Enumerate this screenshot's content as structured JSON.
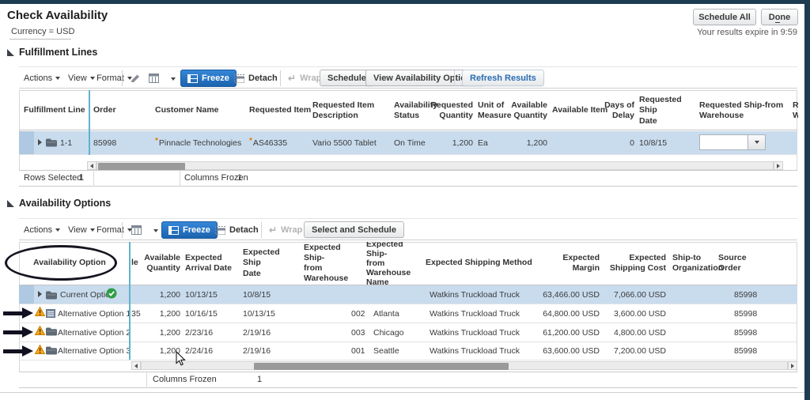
{
  "colors": {
    "frame": "#1d3c52",
    "primary_button": "#2272c3",
    "selected_row": "#c9dcee",
    "frozen_divider": "#5fb3cd",
    "link_blue": "#2a6db5",
    "warning": "#f6a81f",
    "success": "#2f9e47",
    "annotation": "#15151f",
    "required_marker": "#e07c00"
  },
  "header": {
    "title": "Check Availability",
    "subtitle": "Currency = USD",
    "schedule_all_label": "Schedule All",
    "done": {
      "pre": "D",
      "accent": "o",
      "post": "ne"
    },
    "expire_note": "Your results expire in 9:59"
  },
  "toolbar": {
    "actions": "Actions",
    "view": "View",
    "format": "Format",
    "freeze": "Freeze",
    "detach": "Detach",
    "wrap": "Wrap"
  },
  "fulfillment": {
    "section_title": "Fulfillment Lines",
    "schedule_label": "Schedule",
    "view_options_label": "View Availability Options",
    "refresh_label": "Refresh Results",
    "columns": {
      "line": "Fulfillment Line",
      "order": "Order",
      "customer": "Customer Name",
      "item": "Requested Item",
      "description": "Requested Item\nDescription",
      "status": "Availability\nStatus",
      "req_qty": "Requested\nQuantity",
      "uom": "Unit of\nMeasure",
      "avail_qty": "Available\nQuantity",
      "avail_item": "Available Item",
      "delay": "Days of\nDelay",
      "ship_date": "Requested Ship\nDate",
      "ship_wh": "Requested Ship-from\nWarehouse",
      "clipped": "R\nW"
    },
    "row": {
      "marker": "*",
      "line": "1-1",
      "order": "85998",
      "customer": "Pinnacle Technologies",
      "item": "AS46335",
      "description": "Vario 5500 Tablet",
      "status": "On Time",
      "req_qty": "1,200",
      "uom": "Ea",
      "avail_qty": "1,200",
      "avail_item": "",
      "delay": "0",
      "ship_date": "10/8/15"
    },
    "footer": {
      "rows_selected_label": "Rows Selected",
      "rows_selected_value": "1",
      "columns_frozen_label": "Columns Frozen",
      "columns_frozen_value": "1"
    }
  },
  "options": {
    "section_title": "Availability Options",
    "select_schedule_label": "Select and Schedule",
    "columns": {
      "option": "Availability Option",
      "clipped": "le",
      "qty": "Available\nQuantity",
      "arrival": "Expected\nArrival Date",
      "ship": "Expected Ship\nDate",
      "wh": "Expected Ship-\nfrom\nWarehouse",
      "wh_name": "Expected Ship-\nfrom\nWarehouse\nName",
      "method": "Expected Shipping Method",
      "margin": "Expected\nMargin",
      "cost": "Expected\nShipping Cost",
      "ship_to": "Ship-to\nOrganization",
      "source": "Source Order"
    },
    "rows": [
      {
        "name": "Current Option",
        "clipped": "",
        "qty": "1,200",
        "arrival": "10/13/15",
        "ship": "10/8/15",
        "wh": "",
        "wh_name": "",
        "method": "Watkins Truckload Truck",
        "margin": "63,466.00 USD",
        "cost": "7,066.00 USD",
        "ship_to": "",
        "source": "85998"
      },
      {
        "name": "Alternative Option 1",
        "clipped": "35",
        "qty": "1,200",
        "arrival": "10/16/15",
        "ship": "10/13/15",
        "wh": "002",
        "wh_name": "Atlanta",
        "method": "Watkins Truckload Truck",
        "margin": "64,800.00 USD",
        "cost": "3,600.00 USD",
        "ship_to": "",
        "source": "85998"
      },
      {
        "name": "Alternative Option 2",
        "clipped": "",
        "qty": "1,200",
        "arrival": "2/23/16",
        "ship": "2/19/16",
        "wh": "003",
        "wh_name": "Chicago",
        "method": "Watkins Truckload Truck",
        "margin": "61,200.00 USD",
        "cost": "4,800.00 USD",
        "ship_to": "",
        "source": "85998"
      },
      {
        "name": "Alternative Option 3",
        "clipped": "",
        "qty": "1,200",
        "arrival": "2/24/16",
        "ship": "2/19/16",
        "wh": "001",
        "wh_name": "Seattle",
        "method": "Watkins Truckload Truck",
        "margin": "63,600.00 USD",
        "cost": "7,200.00 USD",
        "ship_to": "",
        "source": "85998"
      }
    ],
    "footer": {
      "columns_frozen_label": "Columns Frozen",
      "columns_frozen_value": "1"
    }
  }
}
